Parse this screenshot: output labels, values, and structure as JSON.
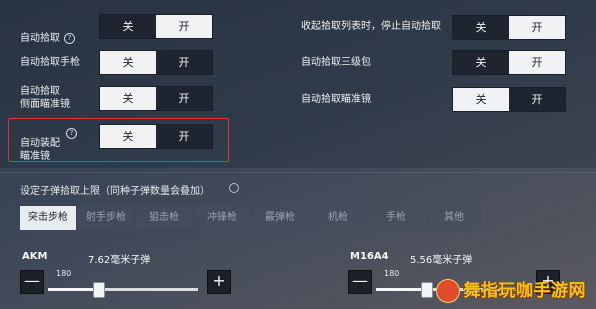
{
  "toggles_left": [
    {
      "label": "自动拾取",
      "has_help": true,
      "off": "关",
      "on": "开",
      "state": "on"
    },
    {
      "label": "自动拾取手枪",
      "has_help": false,
      "off": "关",
      "on": "开",
      "state": "off"
    },
    {
      "label": "自动拾取\n侧面瞄准镜",
      "has_help": false,
      "off": "关",
      "on": "开",
      "state": "off"
    },
    {
      "label": "自动装配\n瞄准镜",
      "has_help": true,
      "off": "关",
      "on": "开",
      "state": "off"
    }
  ],
  "toggles_right": [
    {
      "label": "收起拾取列表时，停止自动拾取",
      "off": "关",
      "on": "开",
      "state": "on"
    },
    {
      "label": "自动拾取三级包",
      "off": "关",
      "on": "开",
      "state": "on"
    },
    {
      "label": "自动拾取瞄准镜",
      "off": "关",
      "on": "开",
      "state": "off"
    }
  ],
  "ammo_section": {
    "title": "设定子弹拾取上限（同种子弹数量会叠加）",
    "tabs": [
      "突击步枪",
      "射手步枪",
      "狙击枪",
      "冲锋枪",
      "霰弹枪",
      "机枪",
      "手枪",
      "其他"
    ],
    "active_tab": 0
  },
  "sliders": [
    {
      "gun": "AKM",
      "ammo": "7.62毫米子弹",
      "value": "180",
      "fill": 0.33
    },
    {
      "gun": "M16A4",
      "ammo": "5.56毫米子弹",
      "value": "180",
      "fill": 0.33
    }
  ],
  "controls": {
    "minus": "—",
    "plus": "+"
  },
  "watermark": {
    "text": "舞指玩咖手游网"
  },
  "colors": {
    "highlight": "#d23a3a",
    "toggle_on": "#f1f2f4",
    "toggle_off": "#1e2530"
  }
}
